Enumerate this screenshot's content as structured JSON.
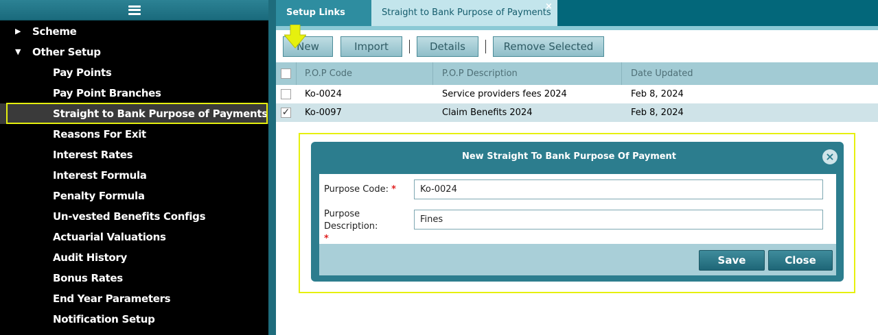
{
  "sidebar": {
    "menu_icon": "hamburger-icon",
    "items": [
      {
        "label": "Scheme",
        "level": 1,
        "expanded": false
      },
      {
        "label": "Other Setup",
        "level": 1,
        "expanded": true
      },
      {
        "label": "Pay Points",
        "level": 2
      },
      {
        "label": "Pay Point Branches",
        "level": 2
      },
      {
        "label": "Straight to Bank Purpose of Payments",
        "level": 2,
        "selected": true
      },
      {
        "label": "Reasons For Exit",
        "level": 2
      },
      {
        "label": "Interest Rates",
        "level": 2
      },
      {
        "label": "Interest Formula",
        "level": 2
      },
      {
        "label": "Penalty Formula",
        "level": 2
      },
      {
        "label": "Un-vested Benefits Configs",
        "level": 2
      },
      {
        "label": "Actuarial Valuations",
        "level": 2
      },
      {
        "label": "Audit History",
        "level": 2
      },
      {
        "label": "Bonus Rates",
        "level": 2
      },
      {
        "label": "End Year Parameters",
        "level": 2
      },
      {
        "label": "Notification Setup",
        "level": 2
      }
    ]
  },
  "tabs": [
    {
      "label": "Setup Links",
      "active": true
    },
    {
      "label": "Straight to Bank Purpose of Payments",
      "active": false,
      "close": "×"
    }
  ],
  "toolbar": {
    "new_label": "New",
    "import_label": "Import",
    "details_label": "Details",
    "remove_label": "Remove Selected"
  },
  "grid": {
    "columns": [
      "P.O.P Code",
      "P.O.P Description",
      "Date Updated"
    ],
    "rows": [
      {
        "code": "Ko-0024",
        "description": "Service providers fees 2024",
        "date": "Feb 8, 2024",
        "checked": false
      },
      {
        "code": "Ko-0097",
        "description": "Claim Benefits 2024",
        "date": "Feb 8, 2024",
        "checked": true
      }
    ]
  },
  "modal": {
    "title": "New Straight To Bank Purpose Of Payment",
    "close_icon": "close-circle-icon",
    "code_label": "Purpose Code:",
    "description_label": "Purpose Description:",
    "required_mark": "*",
    "code_value": "Ko-0024",
    "description_value": "Fines",
    "save_label": "Save",
    "close_label": "Close"
  },
  "colors": {
    "highlight": "#e6f00e",
    "accent": "#2c7d8e",
    "sidebar_bg": "#000000",
    "required": "#e02020"
  }
}
